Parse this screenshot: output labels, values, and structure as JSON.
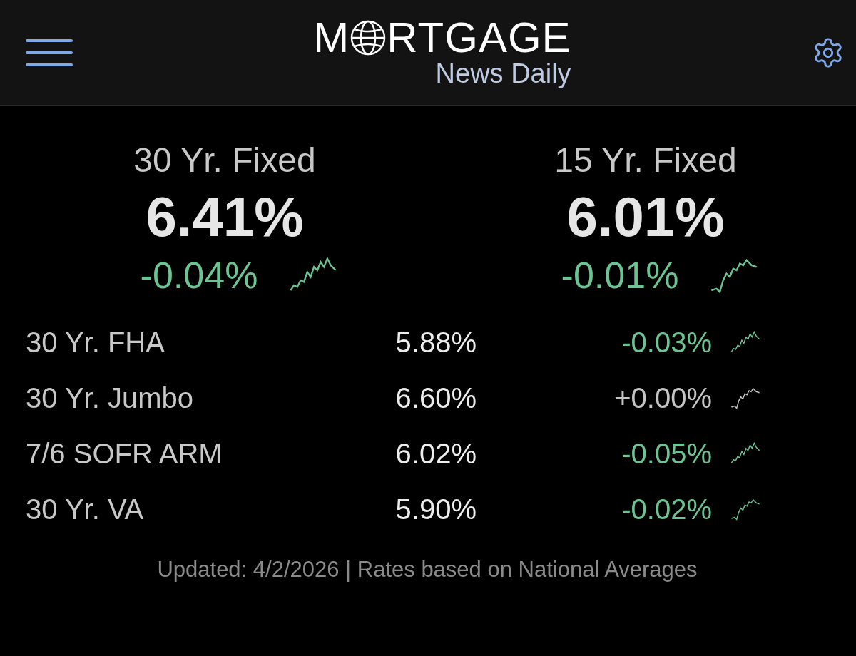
{
  "header": {
    "logo": {
      "first": "M",
      "rest": "RTGAGE",
      "subtitle": "News Daily"
    }
  },
  "featured": [
    {
      "name": "30 Yr. Fixed",
      "rate": "6.41%",
      "change": "-0.04%",
      "color": "#6cc393"
    },
    {
      "name": "15 Yr. Fixed",
      "rate": "6.01%",
      "change": "-0.01%",
      "color": "#6cc393"
    }
  ],
  "rates": [
    {
      "name": "30 Yr. FHA",
      "rate": "5.88%",
      "change": "-0.03%",
      "color": "#6cc393"
    },
    {
      "name": "30 Yr. Jumbo",
      "rate": "6.60%",
      "change": "+0.00%",
      "color": "#c4c4c4"
    },
    {
      "name": "7/6 SOFR ARM",
      "rate": "6.02%",
      "change": "-0.05%",
      "color": "#6cc393"
    },
    {
      "name": "30 Yr. VA",
      "rate": "5.90%",
      "change": "-0.02%",
      "color": "#6cc393"
    }
  ],
  "footer": "Updated: 4/2/2026 | Rates based on National Averages"
}
